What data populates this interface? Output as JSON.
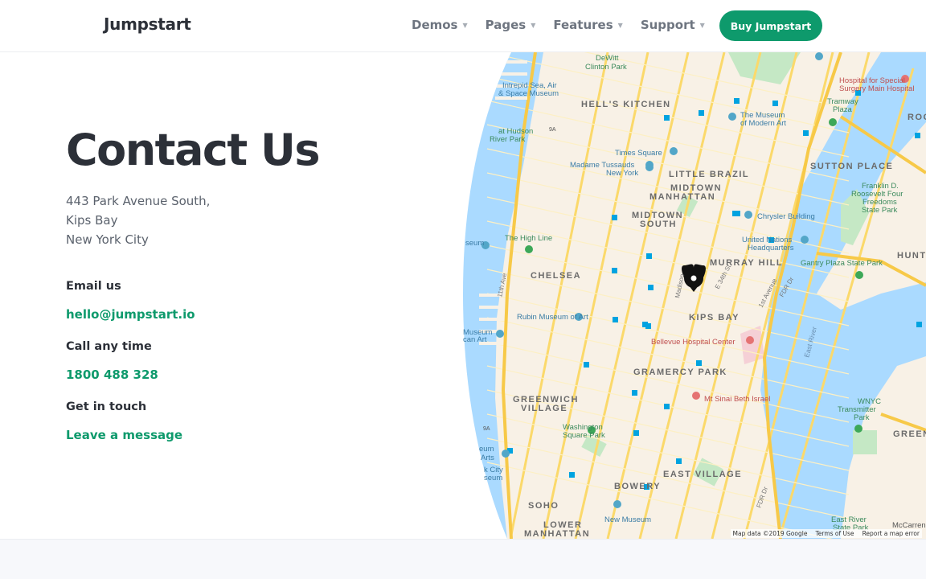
{
  "brand": {
    "name": "Jumpstart"
  },
  "nav": {
    "items": [
      {
        "label": "Demos"
      },
      {
        "label": "Pages"
      },
      {
        "label": "Features"
      },
      {
        "label": "Support"
      }
    ],
    "cta_label": "Buy Jumpstart"
  },
  "contact": {
    "title": "Contact Us",
    "address": [
      "443 Park Avenue South,",
      "Kips Bay",
      "New York City"
    ],
    "email_label": "Email us",
    "email": "hello@jumpstart.io",
    "call_label": "Call any time",
    "phone": "1800 488 328",
    "touch_label": "Get in touch",
    "message_link": "Leave a message"
  },
  "map": {
    "labels": {
      "hells_kitchen": "HELL'S KITCHEN",
      "little_brazil": "LITTLE BRAZIL",
      "midtown_a": "MIDTOWN",
      "manhattan_a": "MANHATTAN",
      "midtown_b": "MIDTOWN",
      "south": "SOUTH",
      "sutton_place": "SUTTON PLACE",
      "murray_hill": "MURRAY HILL",
      "chelsea": "CHELSEA",
      "kips_bay": "KIPS BAY",
      "gramercy_park": "GRAMERCY PARK",
      "greenwich": "GREENWICH",
      "village": "VILLAGE",
      "east_village": "EAST VILLAGE",
      "bowery": "BOWERY",
      "soho": "SOHO",
      "lower": "LOWER",
      "manhattan_b": "MANHATTAN",
      "hunt": "HUNT",
      "green": "GREEN",
      "rooc": "ROO",
      "dewitt_a": "DeWitt",
      "dewitt_b": "Clinton Park",
      "intrepid_a": "Intrepid Sea, Air",
      "intrepid_b": "& Space Museum",
      "hudson_a": "at Hudson",
      "hudson_b": "River Park",
      "times_square": "Times Square",
      "tussauds_a": "Madame Tussauds",
      "tussauds_b": "New York",
      "moma_a": "The Museum",
      "moma_b": "of Modern Art",
      "hss_a": "Hospital for Special",
      "hss_b": "Surgery Main Hospital",
      "tramway_a": "Tramway",
      "tramway_b": "Plaza",
      "fdr_a": "Franklin D.",
      "fdr_b": "Roosevelt Four",
      "fdr_c": "Freedoms",
      "fdr_d": "State Park",
      "chrysler": "Chrysler Building",
      "high_line": "The High Line",
      "un_a": "United Nations",
      "un_b": "Headquarters",
      "gantry": "Gantry Plaza State Park",
      "rubin": "Rubin Museum of Art",
      "bellevue": "Bellevue Hospital Center",
      "sinai": "Mt Sinai Beth Israel",
      "wsp_a": "Washington",
      "wsp_b": "Square Park",
      "wnyc_a": "WNYC",
      "wnyc_b": "Transmitter",
      "wnyc_c": "Park",
      "new_museum": "New Museum",
      "eriver_a": "East River",
      "eriver_b": "State Park",
      "mccarren": "McCarren",
      "east_river": "East River",
      "fdr_dr": "FDR Dr",
      "fdr_dr2": "FDR Dr",
      "eleventh_ave": "11th Ave",
      "madison": "Madison",
      "e34": "E 34th St",
      "first_ave": "1st Avenue",
      "museum_a": "Museum",
      "museum_b": "can Art",
      "eum_a": "eum",
      "eum_b": "Arts",
      "city_a": "k City",
      "city_b": "seum",
      "route9a": "9A",
      "route9a2": "9A",
      "seum": "seum"
    },
    "attribution": [
      "Map data ©2019 Google",
      "Terms of Use",
      "Report a map error"
    ]
  },
  "colors": {
    "accent": "#0e9a6c",
    "water": "#aadaff",
    "land": "#f8f1e6",
    "park": "#c5e8c5",
    "road": "#fbd96b"
  }
}
